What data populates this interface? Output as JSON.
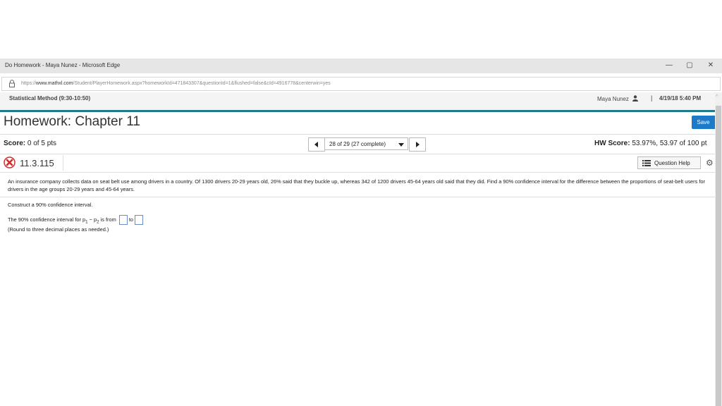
{
  "window": {
    "title": "Do Homework - Maya Nunez - Microsoft Edge",
    "minimize": "—",
    "restore": "▢",
    "close": "✕"
  },
  "address": {
    "url_prefix": "https://",
    "url_domain": "www.mathxl.com",
    "url_path": "/Student/PlayerHomework.aspx?homeworkId=471843307&questionId=1&flushed=false&cId=4916778&centerwin=yes"
  },
  "course_bar": {
    "course": "Statistical Method (9:30-10:50)",
    "user": "Maya Nunez",
    "separator": "|",
    "date": "4/19/18 5:40 PM"
  },
  "header": {
    "title": "Homework: Chapter 11",
    "save_label": "Save"
  },
  "score_bar": {
    "score_label": "Score:",
    "score_value": "0 of 5 pts",
    "nav_text": "28 of 29 (27 complete)",
    "hw_label": "HW Score:",
    "hw_value": "53.97%, 53.97 of 100 pt"
  },
  "question": {
    "id": "11.3.115",
    "help_label": "Question Help",
    "status_color": "#d42c2c",
    "problem_text": "An insurance company collects data on seat belt use among drivers in a country. Of 1300 drivers 20-29 years old, 26% said that they buckle up, whereas 342 of 1200 drivers 45-64 years old said that they did. Find a 90% confidence interval for the difference between the proportions of seat-belt users for drivers in the age groups 20-29 years and 45-64 years.",
    "instruction": "Construct a 90% confidence interval.",
    "answer_prefix": "The 90% confidence interval for p",
    "sub1": "1",
    "minus": " − p",
    "sub2": "2",
    "is_from": " is from",
    "to": "to",
    "round_note": "(Round to three decimal places as needed.)"
  },
  "colors": {
    "accent_teal": "#1e7a8c",
    "save_blue": "#1c7ac9",
    "input_border": "#6a8ec6"
  }
}
